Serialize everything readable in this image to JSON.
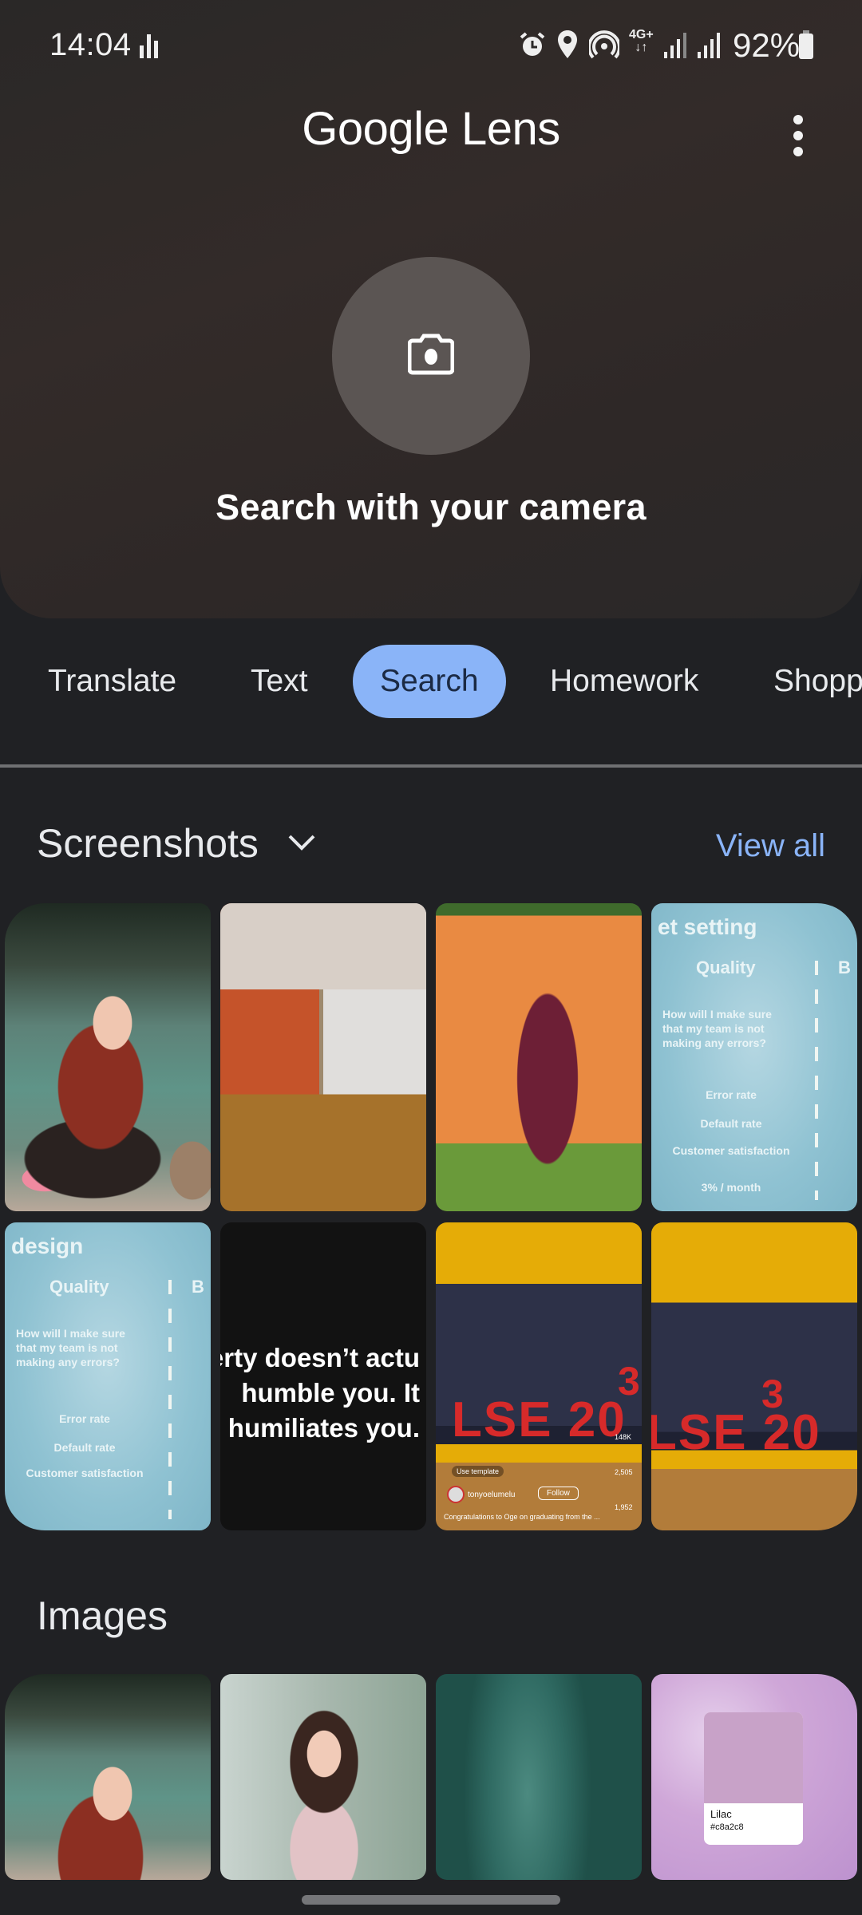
{
  "status_bar": {
    "time": "14:04",
    "network_type": "4G+",
    "battery_percent": "92%",
    "icons": [
      "activity-bars-icon",
      "alarm-icon",
      "location-icon",
      "hotspot-icon",
      "data-arrows-icon",
      "signal-icon",
      "signal-icon",
      "battery-icon"
    ]
  },
  "header": {
    "title_google": "Google",
    "title_lens": "Lens",
    "menu_icon": "more-vert-icon"
  },
  "camera": {
    "icon": "camera-icon",
    "label": "Search with your camera"
  },
  "modes": {
    "tabs": [
      {
        "label": "Translate",
        "active": false
      },
      {
        "label": "Text",
        "active": false
      },
      {
        "label": "Search",
        "active": true
      },
      {
        "label": "Homework",
        "active": false
      },
      {
        "label": "Shopping",
        "active": false
      }
    ],
    "accent_color": "#8ab4f8"
  },
  "screenshots": {
    "title": "Screenshots",
    "view_all": "View all",
    "items": [
      {
        "desc": "Woman in red halter top among lotus leaves"
      },
      {
        "desc": "Photo studio with orange wall and suit mannequin"
      },
      {
        "desc": "Man in burgundy suit before orange banner"
      },
      {
        "desc": "Slide: goal setting quality",
        "heading": "et setting",
        "col_a": "Quality",
        "col_b": "B",
        "question": "How will I make sure that my team is not making any errors?",
        "metrics": [
          "Error rate",
          "Default rate",
          "Customer satisfaction",
          "3% / month"
        ]
      },
      {
        "desc": "Slide: design quality",
        "heading": "design",
        "col_a": "Quality",
        "col_b": "B",
        "question": "How will I make sure that my team is not making any errors?",
        "metrics": [
          "Error rate",
          "Default rate",
          "Customer satisfaction"
        ]
      },
      {
        "desc": "Quote on black",
        "quote_lines": [
          "erty doesn’t actu",
          "humble you. It",
          "humiliates you."
        ]
      },
      {
        "desc": "LSE 2023 letters reel",
        "letters": "LSE 20",
        "digit": "3",
        "template_label": "Use template",
        "username": "tonyoelumelu",
        "follow": "Follow",
        "likes": "148K",
        "comments": "2,505",
        "shares": "1,952",
        "caption": "Congratulations to Oge on graduating from the ..."
      },
      {
        "desc": "LSE 2023 letters with family",
        "letters": "LSE 20",
        "digit": "3"
      }
    ]
  },
  "images": {
    "title": "Images",
    "items": [
      {
        "desc": "Woman in red halter top among lotus leaves"
      },
      {
        "desc": "Woman in pink lace dress smiling"
      },
      {
        "desc": "Teal fabric close-up"
      },
      {
        "desc": "Lilac color swatch",
        "color_name": "Lilac",
        "color_hex": "#c8a2c8"
      }
    ]
  }
}
